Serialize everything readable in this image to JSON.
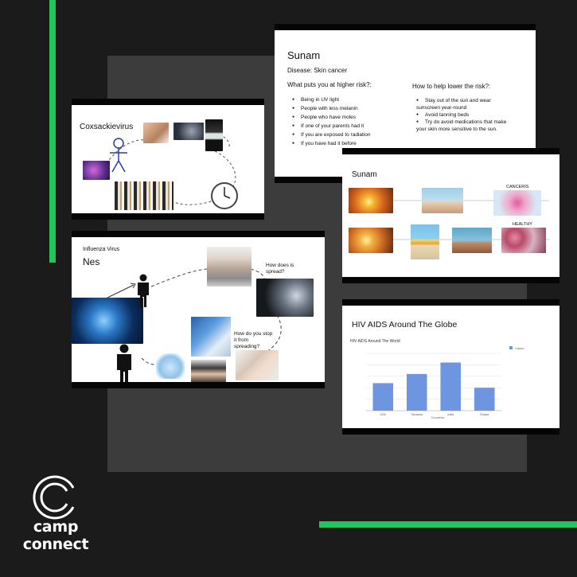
{
  "slide1": {
    "title": "Coxsackievirus"
  },
  "slide2": {
    "title": "Sunam",
    "disease": "Disease: Skin cancer",
    "risk_heading": "What puts you at higher risk?:",
    "risk_items": [
      "Being in UV light",
      "People with less melanin",
      "People who have moles",
      "If one of your parents had it",
      "If you are exposed to radiation",
      "If you have had it before"
    ],
    "help_heading": "How to help lower the risk?:",
    "help_items": [
      "Stay out of the sun and wear sunscreen year-round",
      "Avoid tanning beds",
      "Try do avoid medications that make your skin more sensitive to the sun."
    ]
  },
  "slide3": {
    "title": "Sunam",
    "label_cancer": "CANCERIS",
    "label_healthy": "HEALTHY"
  },
  "slide4": {
    "subtitle": "Influenza Virus",
    "title": "Nes",
    "question1": "How does is spread?",
    "question2": "How do you stop it from spreading?"
  },
  "slide5": {
    "title": "HIV AIDS Around The Globe"
  },
  "chart_data": {
    "type": "bar",
    "title": "HIV AIDS Around The World",
    "categories": [
      "USA",
      "Tanzania",
      "India",
      "Russia"
    ],
    "series": [
      {
        "name": "Cases",
        "values": [
          1200000,
          1600000,
          2100000,
          1000000
        ]
      }
    ],
    "xlabel": "Countries",
    "ylabel": "",
    "ylim": [
      0,
      2500000
    ],
    "legend": "top-right",
    "grid": true,
    "color": "#6d95e0"
  },
  "brand": {
    "line1": "camp",
    "line2": "connect",
    "accent": "#22c55e"
  }
}
